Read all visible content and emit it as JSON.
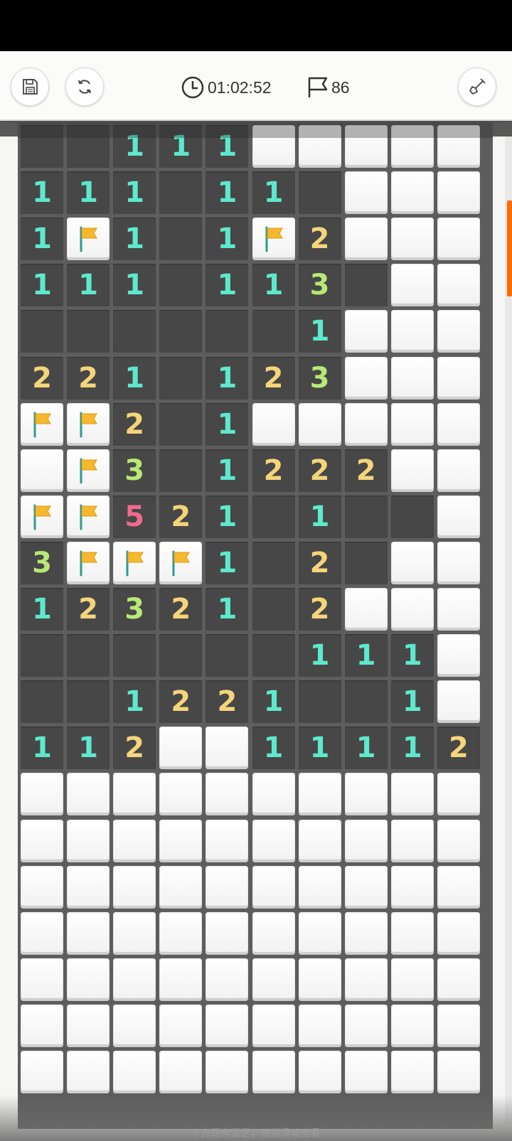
{
  "header": {
    "save_icon": "save-icon",
    "restart_icon": "restart-icon",
    "timer_icon": "clock-icon",
    "timer_value": "01:02:52",
    "flag_icon": "flag-outline-icon",
    "flag_count": "86",
    "shovel_icon": "shovel-icon"
  },
  "board": {
    "columns": 10,
    "rows_visible": 21,
    "legend": "'.' = unopened tile, 'F' = flagged tile, '0' = opened empty tile, digits = adjacent mine count",
    "rows": [
      "00111.....",
      "1110110...",
      "1F101F2...",
      "11101130..",
      "0000001...",
      "2210123...",
      "FF201.....",
      ".F301222..",
      "FF5210100.",
      "3FFF1020..",
      "1232102...",
      "000000111.",
      "001221001.",
      "112..11112",
      "..........",
      "..........",
      "..........",
      "..........",
      "..........",
      "..........",
      ".........."
    ],
    "number_colors": {
      "1": "#5ee8cc",
      "2": "#f5d57a",
      "3": "#b8e876",
      "5": "#f06a8e"
    },
    "flag_color": "#f5b82e"
  },
  "footer": {
    "note": "下方还有雷区，使用滑动查看"
  },
  "colors": {
    "accent": "#ff6a00",
    "board_bg": "#5d5d5d",
    "open_cell": "#474747"
  }
}
